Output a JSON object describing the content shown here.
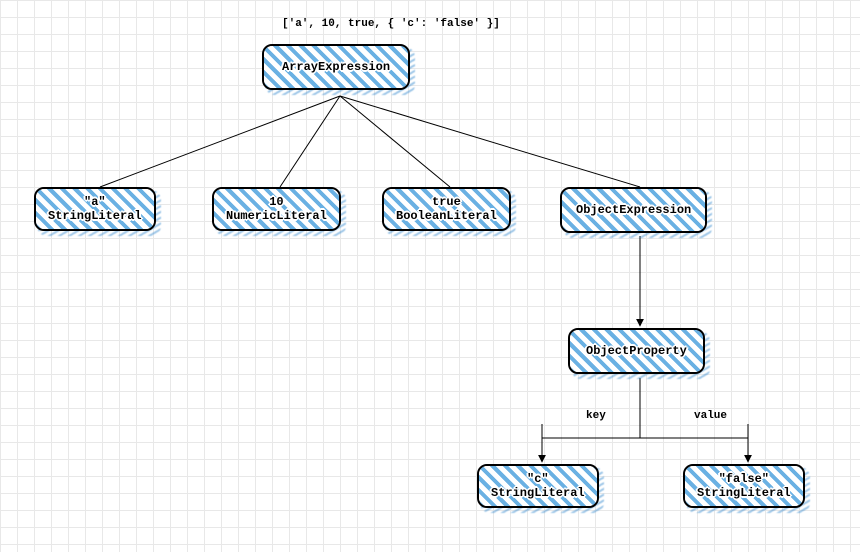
{
  "title": "['a', 10, true, { 'c': 'false' }]",
  "nodes": {
    "root": {
      "label": "ArrayExpression"
    },
    "n1": {
      "value": "\"a\"",
      "type": "StringLiteral"
    },
    "n2": {
      "value": "10",
      "type": "NumericLiteral"
    },
    "n3": {
      "value": "true",
      "type": "BooleanLiteral"
    },
    "n4": {
      "label": "ObjectExpression"
    },
    "n5": {
      "label": "ObjectProperty"
    },
    "n6": {
      "value": "\"c\"",
      "type": "StringLiteral"
    },
    "n7": {
      "value": "\"false\"",
      "type": "StringLiteral"
    }
  },
  "edgeLabels": {
    "key": "key",
    "value": "value"
  },
  "chart_data": {
    "type": "tree",
    "title": "['a', 10, true, { 'c': 'false' }]",
    "root": {
      "label": "ArrayExpression",
      "children": [
        {
          "label": "StringLiteral",
          "value": "\"a\""
        },
        {
          "label": "NumericLiteral",
          "value": "10"
        },
        {
          "label": "BooleanLiteral",
          "value": "true"
        },
        {
          "label": "ObjectExpression",
          "children": [
            {
              "label": "ObjectProperty",
              "children": [
                {
                  "edge": "key",
                  "label": "StringLiteral",
                  "value": "\"c\""
                },
                {
                  "edge": "value",
                  "label": "StringLiteral",
                  "value": "\"false\""
                }
              ]
            }
          ]
        }
      ]
    }
  }
}
